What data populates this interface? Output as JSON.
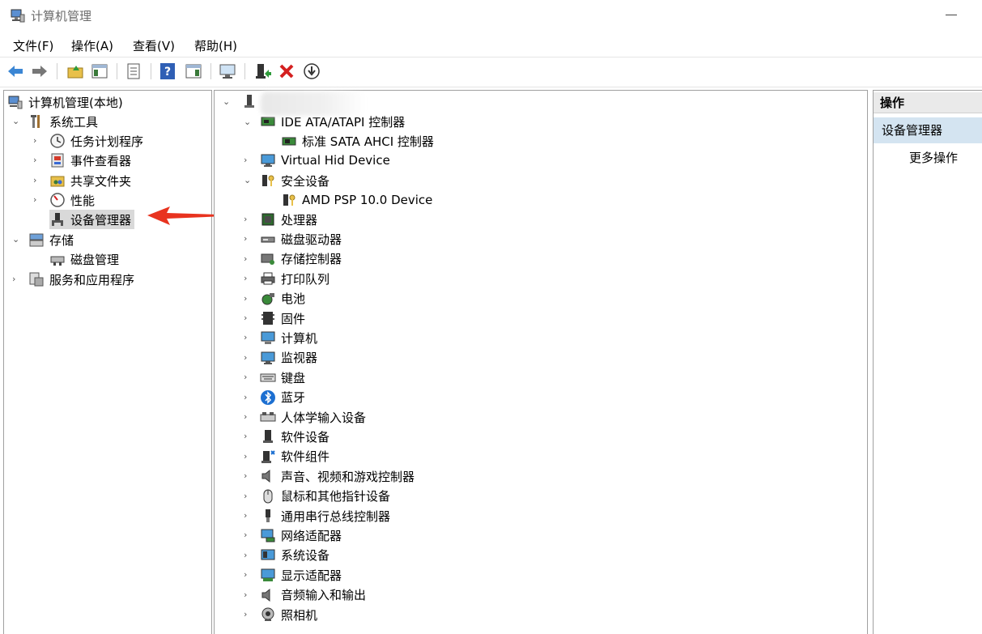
{
  "window": {
    "title": "计算机管理"
  },
  "menu": {
    "file": "文件(F)",
    "action": "操作(A)",
    "view": "查看(V)",
    "help": "帮助(H)"
  },
  "left_tree": {
    "root": "计算机管理(本地)",
    "system_tools": "系统工具",
    "task_scheduler": "任务计划程序",
    "event_viewer": "事件查看器",
    "shared_folders": "共享文件夹",
    "performance": "性能",
    "device_manager": "设备管理器",
    "storage": "存储",
    "disk_management": "磁盘管理",
    "services_apps": "服务和应用程序"
  },
  "device_tree": {
    "ide_controller": "IDE ATA/ATAPI 控制器",
    "sata_controller": "标准 SATA AHCI 控制器",
    "items": [
      {
        "label": "Virtual Hid Device",
        "icon": "monitor-icon"
      },
      {
        "label": "安全设备",
        "icon": "key-icon"
      },
      {
        "label": "AMD PSP 10.0 Device",
        "icon": "key-icon"
      },
      {
        "label": "处理器",
        "icon": "chip-icon"
      },
      {
        "label": "磁盘驱动器",
        "icon": "disk-icon"
      },
      {
        "label": "存储控制器",
        "icon": "storage-icon"
      },
      {
        "label": "打印队列",
        "icon": "printer-icon"
      },
      {
        "label": "电池",
        "icon": "battery-icon"
      },
      {
        "label": "固件",
        "icon": "firmware-icon"
      },
      {
        "label": "计算机",
        "icon": "computer-icon"
      },
      {
        "label": "监视器",
        "icon": "monitor-icon"
      },
      {
        "label": "键盘",
        "icon": "keyboard-icon"
      },
      {
        "label": "蓝牙",
        "icon": "bluetooth-icon"
      },
      {
        "label": "人体学输入设备",
        "icon": "hid-icon"
      },
      {
        "label": "软件设备",
        "icon": "software-device-icon"
      },
      {
        "label": "软件组件",
        "icon": "software-component-icon"
      },
      {
        "label": "声音、视频和游戏控制器",
        "icon": "speaker-icon"
      },
      {
        "label": "鼠标和其他指针设备",
        "icon": "mouse-icon"
      },
      {
        "label": "通用串行总线控制器",
        "icon": "usb-icon"
      },
      {
        "label": "网络适配器",
        "icon": "network-icon"
      },
      {
        "label": "系统设备",
        "icon": "system-icon"
      },
      {
        "label": "显示适配器",
        "icon": "display-adapter-icon"
      },
      {
        "label": "音频输入和输出",
        "icon": "speaker-icon"
      },
      {
        "label": "照相机",
        "icon": "camera-icon"
      }
    ]
  },
  "actions": {
    "header": "操作",
    "section": "设备管理器",
    "more": "更多操作"
  },
  "colors": {
    "arrow": "#e8331f",
    "selected": "#d9d9d9",
    "actions_section": "#d4e4f1"
  }
}
